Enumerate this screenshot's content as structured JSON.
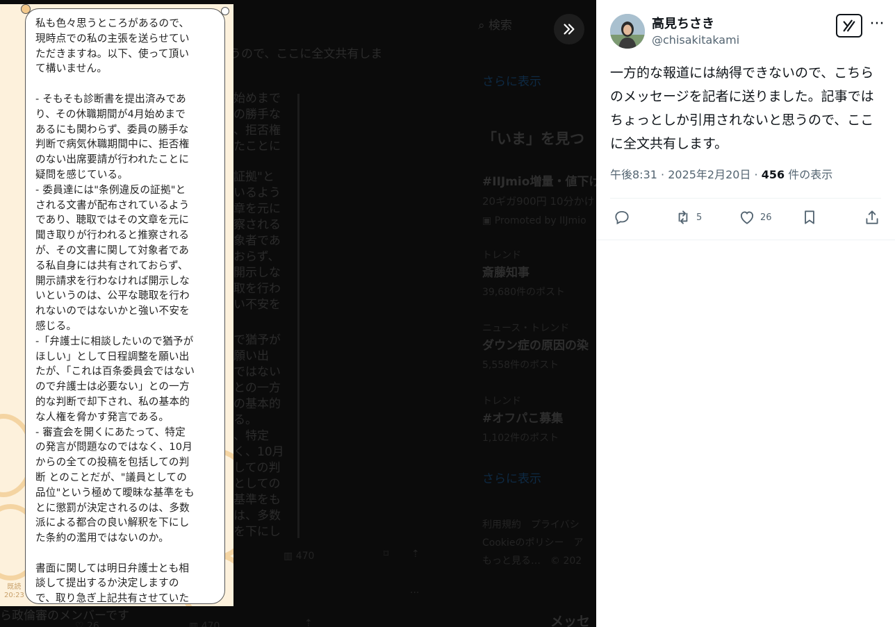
{
  "background": {
    "search_placeholder": "検索",
    "show_more_1": "さらに表示",
    "show_more_2": "さらに表示",
    "header_now": "「いま」を見つ",
    "promo_title": "#IIJmio増量・値下げ",
    "promo_sub": "20ギガ900円 10分かけ",
    "promo_by": "Promoted by IIJmio",
    "trend1_cat": "トレンド",
    "trend1_name": "斎藤知事",
    "trend1_count": "39,680件のポスト",
    "trend2_cat": "ニュース・トレンド",
    "trend2_name": "ダウン症の原因の染",
    "trend2_count": "5,558件のポスト",
    "trend3_cat": "トレンド",
    "trend3_name": "#オフパこ募集",
    "trend3_count": "1,102件のポスト",
    "footer_1": "利用規約　プライバシ",
    "footer_2": "Cookieのポリシー　ア",
    "footer_3": "もっと見る…　© 202",
    "tweet_line_a": "うので、ここに全文共有しま",
    "views_count": "470",
    "likes_count": "26",
    "views_count_bottom": "470",
    "bottom_caption": "ら政倫審のメンバーです",
    "messages_label": "メッセ",
    "fragments": [
      "始めまで",
      "の勝手な",
      "、拒否権",
      "たことに",
      "証拠\"と",
      "いるよう",
      "章を元に",
      "察される",
      "象者であ",
      "おらず、",
      "開示しな",
      "取を行わ",
      "い不安を",
      "で猶予が",
      "願い出",
      "ではない",
      "との一方",
      "の基本的",
      "る。",
      "、特定",
      "く、10月",
      "しての判",
      "としての",
      "基準をも",
      "は、多数",
      "を下にし"
    ]
  },
  "chat_image": {
    "message": "私も色々思うところがあるので、\n現時点での私の主張を送らせてい\nただきますね。以下、使って頂い\nて構いません。\n\n- そもそも診断書を提出済みであ\nり、その休職期間が4月始めまで\nあるにも関わらず、委員の勝手な\n判断で病気休職期間中に、拒否権\nのない出席要請が行われたことに\n疑問を感じている。\n- 委員達には\"条例違反の証拠\"と\nされる文書が配布されているよう\nであり、聴取ではその文章を元に\n聞き取りが行われると推察される\nが、その文書に関して対象者であ\nる私自身には共有されておらず、\n開示請求を行わなければ開示しな\nいというのは、公平な聴取を行わ\nれないのではないかと強い不安を\n感じる。\n-「弁護士に相談したいので猶予が\nほしい」として日程調整を願い出\nたが、「これは百条委員会ではない\nので弁護士は必要ない」との一方\n的な判断で却下され、私の基本的\nな人権を脅かす発言である。\n- 審査会を開くにあたって、特定\nの発言が問題なのではなく、10月\nからの全ての投稿を包括しての判\n断 とのことだが、\"議員としての\n品位\"という極めて曖昧な基準をも\nとに懲罰が決定されるのは、多数\n派による都合の良い解釈を下にし\nた条約の濫用ではないのか。\n\n書面に関しては明日弁護士とも相\n談して提出するか決定しますの\nで、取り急ぎ上記共有させていた\nだきますね。",
    "read_label": "既読",
    "time": "20:23"
  },
  "tweet": {
    "display_name": "高見ちさき",
    "handle": "@chisakitakami",
    "text": "一方的な報道には納得できないので、こちらのメッセージを記者に送りました。記事ではちょっとしか引用されないと思うので、ここに全文共有します。",
    "time": "午後8:31",
    "sep": " · ",
    "date": "2025年2月20日",
    "views": "456",
    "views_label": " 件の表示",
    "retweets": "5",
    "likes": "26",
    "more_icon_text": "···"
  },
  "icons": {
    "expand": "double-chevron-right-icon",
    "grok": "grok-icon",
    "reply": "reply-icon",
    "retweet": "retweet-icon",
    "like": "heart-icon",
    "bookmark": "bookmark-icon",
    "share": "share-icon"
  },
  "colors": {
    "panel_bg": "#ffffff",
    "chat_bg": "#fdf1dc",
    "chat_deco": "#f4d4a2",
    "text_primary": "#0f1419",
    "text_secondary": "#536471",
    "overlay": "#000000"
  }
}
